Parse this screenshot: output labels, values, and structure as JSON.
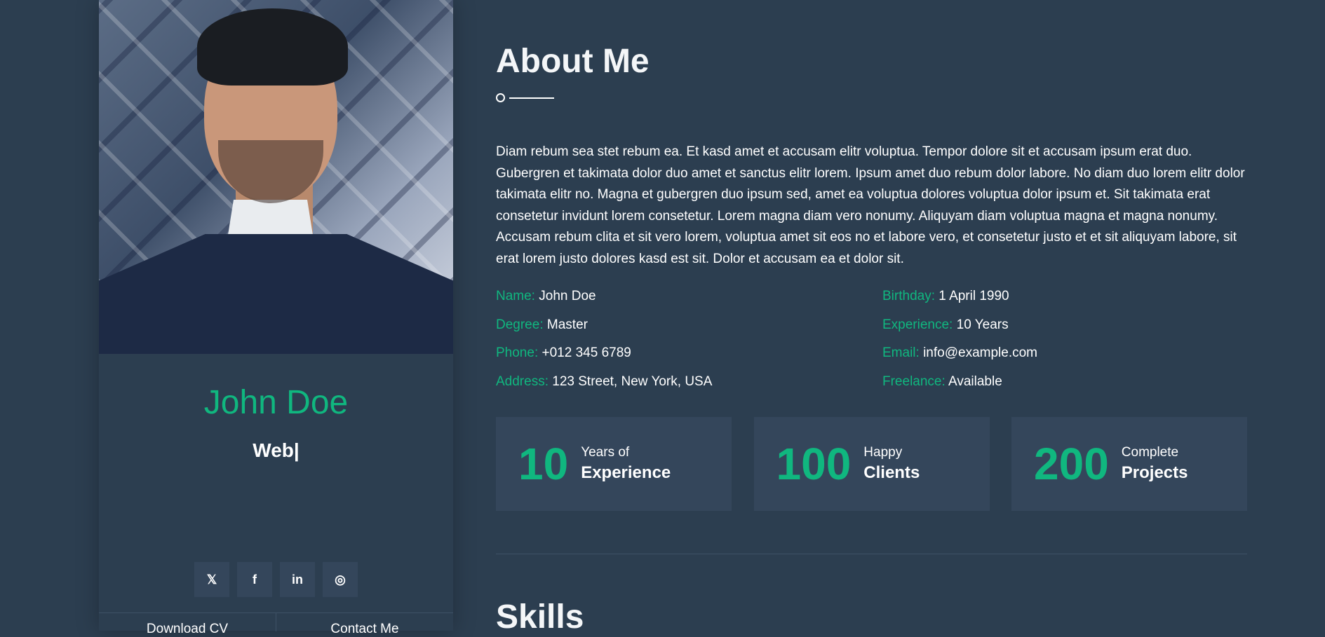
{
  "profile": {
    "name": "John Doe",
    "role": "Web|",
    "photo_alt": "profile-photo",
    "socials": [
      {
        "label": "𝕏",
        "icon": "twitter-icon"
      },
      {
        "label": "f",
        "icon": "facebook-icon"
      },
      {
        "label": "in",
        "icon": "linkedin-icon"
      },
      {
        "label": "◎",
        "icon": "instagram-icon"
      }
    ],
    "buttons": {
      "download": "Download CV",
      "contact": "Contact Me"
    }
  },
  "about": {
    "title": "About Me",
    "text": "Diam rebum sea stet rebum ea. Et kasd amet et accusam elitr voluptua. Tempor dolore sit et accusam ipsum erat duo. Gubergren et takimata dolor duo amet et sanctus elitr lorem. Ipsum amet duo rebum dolor labore. No diam duo lorem elitr dolor takimata elitr no. Magna et gubergren duo ipsum sed, amet ea voluptua dolores voluptua dolor ipsum et. Sit takimata erat consetetur invidunt lorem consetetur. Lorem magna diam vero nonumy. Aliquyam diam voluptua magna et magna nonumy. Accusam rebum clita et sit vero lorem, voluptua amet sit eos no et labore vero, et consetetur justo et et sit aliquyam labore, sit erat lorem justo dolores kasd est sit. Dolor et accusam ea et dolor sit.",
    "info": [
      {
        "key": "Name:",
        "value": "John Doe"
      },
      {
        "key": "Birthday:",
        "value": "1 April 1990"
      },
      {
        "key": "Degree:",
        "value": "Master"
      },
      {
        "key": "Experience:",
        "value": "10 Years"
      },
      {
        "key": "Phone:",
        "value": "+012 345 6789"
      },
      {
        "key": "Email:",
        "value": "info@example.com"
      },
      {
        "key": "Address:",
        "value": "123 Street, New York, USA"
      },
      {
        "key": "Freelance:",
        "value": "Available"
      }
    ],
    "stats": [
      {
        "num": "10",
        "label1": "Years of",
        "label2": "Experience"
      },
      {
        "num": "100",
        "label1": "Happy",
        "label2": "Clients"
      },
      {
        "num": "200",
        "label1": "Complete",
        "label2": "Projects"
      }
    ]
  },
  "skills": {
    "title": "Skills"
  },
  "colors": {
    "background": "#2c3e50",
    "card": "#34465b",
    "accent": "#10b77f",
    "text": "#ffffff"
  }
}
